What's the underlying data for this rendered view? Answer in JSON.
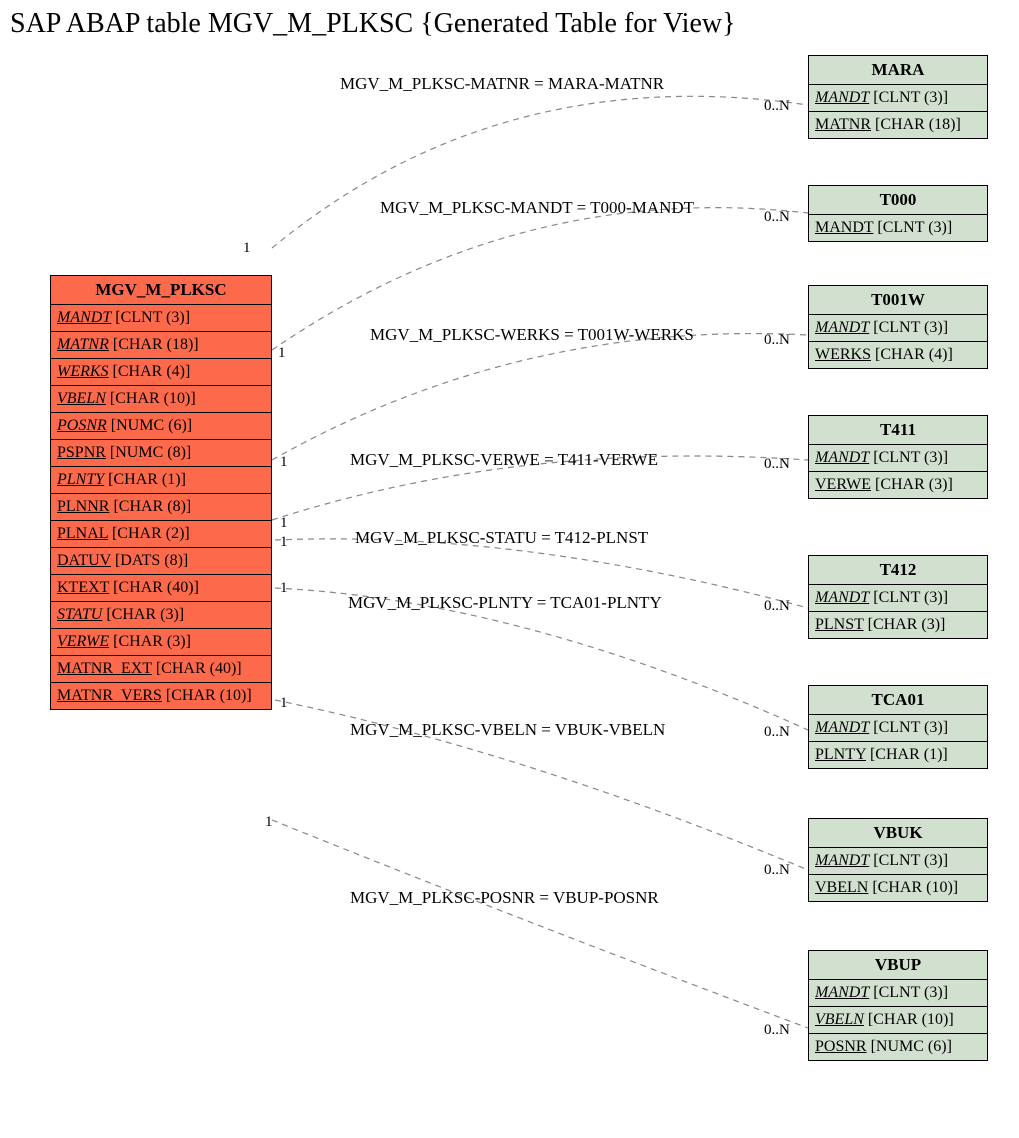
{
  "title": "SAP ABAP table MGV_M_PLKSC {Generated Table for View}",
  "main": {
    "name": "MGV_M_PLKSC",
    "fields": [
      {
        "name": "MANDT",
        "type": "[CLNT (3)]",
        "italic": true
      },
      {
        "name": "MATNR",
        "type": "[CHAR (18)]",
        "italic": true
      },
      {
        "name": "WERKS",
        "type": "[CHAR (4)]",
        "italic": true
      },
      {
        "name": "VBELN",
        "type": "[CHAR (10)]",
        "italic": true
      },
      {
        "name": "POSNR",
        "type": "[NUMC (6)]",
        "italic": true
      },
      {
        "name": "PSPNR",
        "type": "[NUMC (8)]",
        "italic": false
      },
      {
        "name": "PLNTY",
        "type": "[CHAR (1)]",
        "italic": true
      },
      {
        "name": "PLNNR",
        "type": "[CHAR (8)]",
        "italic": false
      },
      {
        "name": "PLNAL",
        "type": "[CHAR (2)]",
        "italic": false
      },
      {
        "name": "DATUV",
        "type": "[DATS (8)]",
        "italic": false
      },
      {
        "name": "KTEXT",
        "type": "[CHAR (40)]",
        "italic": false
      },
      {
        "name": "STATU",
        "type": "[CHAR (3)]",
        "italic": true
      },
      {
        "name": "VERWE",
        "type": "[CHAR (3)]",
        "italic": true
      },
      {
        "name": "MATNR_EXT",
        "type": "[CHAR (40)]",
        "italic": false
      },
      {
        "name": "MATNR_VERS",
        "type": "[CHAR (10)]",
        "italic": false
      }
    ]
  },
  "related": [
    {
      "name": "MARA",
      "fields": [
        {
          "name": "MANDT",
          "type": "[CLNT (3)]",
          "italic": true
        },
        {
          "name": "MATNR",
          "type": "[CHAR (18)]",
          "italic": false
        }
      ]
    },
    {
      "name": "T000",
      "fields": [
        {
          "name": "MANDT",
          "type": "[CLNT (3)]",
          "italic": false
        }
      ]
    },
    {
      "name": "T001W",
      "fields": [
        {
          "name": "MANDT",
          "type": "[CLNT (3)]",
          "italic": true
        },
        {
          "name": "WERKS",
          "type": "[CHAR (4)]",
          "italic": false
        }
      ]
    },
    {
      "name": "T411",
      "fields": [
        {
          "name": "MANDT",
          "type": "[CLNT (3)]",
          "italic": true
        },
        {
          "name": "VERWE",
          "type": "[CHAR (3)]",
          "italic": false
        }
      ]
    },
    {
      "name": "T412",
      "fields": [
        {
          "name": "MANDT",
          "type": "[CLNT (3)]",
          "italic": true
        },
        {
          "name": "PLNST",
          "type": "[CHAR (3)]",
          "italic": false
        }
      ]
    },
    {
      "name": "TCA01",
      "fields": [
        {
          "name": "MANDT",
          "type": "[CLNT (3)]",
          "italic": true
        },
        {
          "name": "PLNTY",
          "type": "[CHAR (1)]",
          "italic": false
        }
      ]
    },
    {
      "name": "VBUK",
      "fields": [
        {
          "name": "MANDT",
          "type": "[CLNT (3)]",
          "italic": true
        },
        {
          "name": "VBELN",
          "type": "[CHAR (10)]",
          "italic": false
        }
      ]
    },
    {
      "name": "VBUP",
      "fields": [
        {
          "name": "MANDT",
          "type": "[CLNT (3)]",
          "italic": true
        },
        {
          "name": "VBELN",
          "type": "[CHAR (10)]",
          "italic": true
        },
        {
          "name": "POSNR",
          "type": "[NUMC (6)]",
          "italic": false
        }
      ]
    }
  ],
  "relations": [
    {
      "label": "MGV_M_PLKSC-MATNR = MARA-MATNR",
      "left": "1",
      "right": "0..N"
    },
    {
      "label": "MGV_M_PLKSC-MANDT = T000-MANDT",
      "left": "1",
      "right": "0..N"
    },
    {
      "label": "MGV_M_PLKSC-WERKS = T001W-WERKS",
      "left": "1",
      "right": "0..N"
    },
    {
      "label": "MGV_M_PLKSC-VERWE = T411-VERWE",
      "left": "1",
      "right": "0..N"
    },
    {
      "label": "MGV_M_PLKSC-STATU = T412-PLNST",
      "left": "1",
      "right": "0..N"
    },
    {
      "label": "MGV_M_PLKSC-PLNTY = TCA01-PLNTY",
      "left": "1",
      "right": "0..N"
    },
    {
      "label": "MGV_M_PLKSC-VBELN = VBUK-VBELN",
      "left": "1",
      "right": "0..N"
    },
    {
      "label": "MGV_M_PLKSC-POSNR = VBUP-POSNR",
      "left": "1",
      "right": "0..N"
    }
  ]
}
